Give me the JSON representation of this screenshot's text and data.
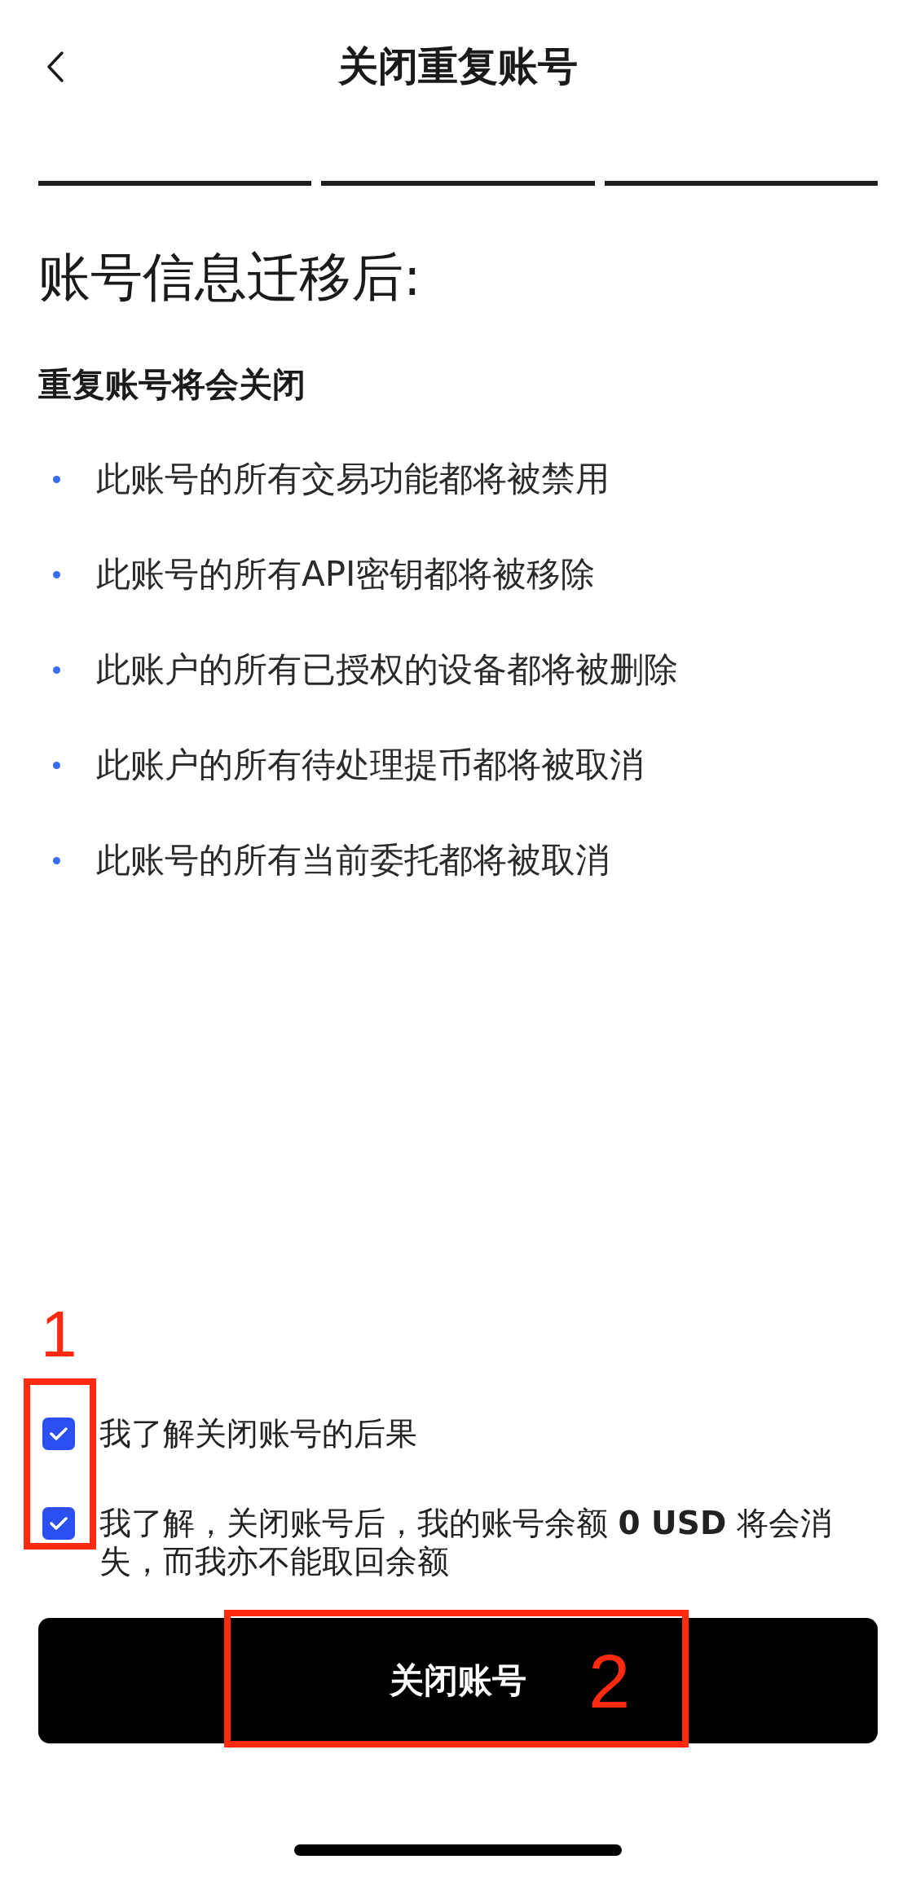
{
  "header": {
    "title": "关闭重复账号"
  },
  "steps": [
    {
      "done": true
    },
    {
      "done": true
    },
    {
      "done": true
    }
  ],
  "heading": "账号信息迁移后:",
  "subheading": "重复账号将会关闭",
  "consequences": [
    "此账号的所有交易功能都将被禁用",
    "此账号的所有API密钥都将被移除",
    "此账户的所有已授权的设备都将被删除",
    "此账户的所有待处理提币都将被取消",
    "此账号的所有当前委托都将被取消"
  ],
  "agreements": [
    {
      "text": "我了解关闭账号的后果",
      "checked": true
    },
    {
      "text": "我了解，关闭账号后，我的账号余额 **0 USD** 将会消失，而我亦不能取回余额",
      "checked": true
    }
  ],
  "button": {
    "label": "关闭账号"
  },
  "annotations": [
    {
      "label": "1",
      "kind": "checkboxes"
    },
    {
      "label": "2",
      "kind": "button"
    }
  ]
}
